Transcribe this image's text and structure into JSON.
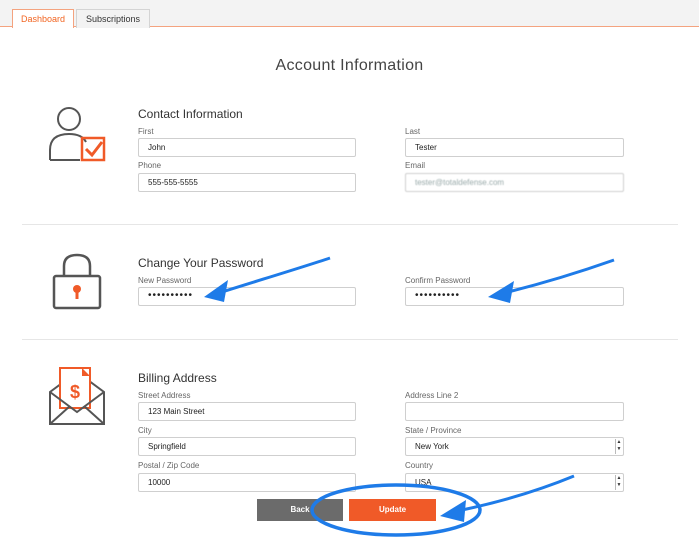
{
  "tabs": [
    {
      "label": "Dashboard",
      "active": true
    },
    {
      "label": "Subscriptions",
      "active": false
    }
  ],
  "page_title": "Account Information",
  "contact": {
    "title": "Contact Information",
    "first_label": "First",
    "first_value": "John",
    "last_label": "Last",
    "last_value": "Tester",
    "phone_label": "Phone",
    "phone_value": "555-555-5555",
    "email_label": "Email",
    "email_value": "tester@totaldefense.com",
    "icon": "user-check-icon"
  },
  "password": {
    "title": "Change Your Password",
    "new_label": "New Password",
    "new_value": "••••••••••",
    "confirm_label": "Confirm Password",
    "confirm_value": "••••••••••",
    "icon": "padlock-icon"
  },
  "billing": {
    "title": "Billing Address",
    "street_label": "Street Address",
    "street_value": "123 Main Street",
    "line2_label": "Address Line 2",
    "line2_value": "",
    "city_label": "City",
    "city_value": "Springfield",
    "state_label": "State / Province",
    "state_value": "New York",
    "zip_label": "Postal / Zip Code",
    "zip_value": "10000",
    "country_label": "Country",
    "country_value": "USA",
    "icon": "envelope-invoice-icon"
  },
  "buttons": {
    "back": "Back",
    "update": "Update"
  },
  "colors": {
    "accent": "#f05a28",
    "annotation": "#1e7be8",
    "back_button": "#6b6b6b"
  }
}
